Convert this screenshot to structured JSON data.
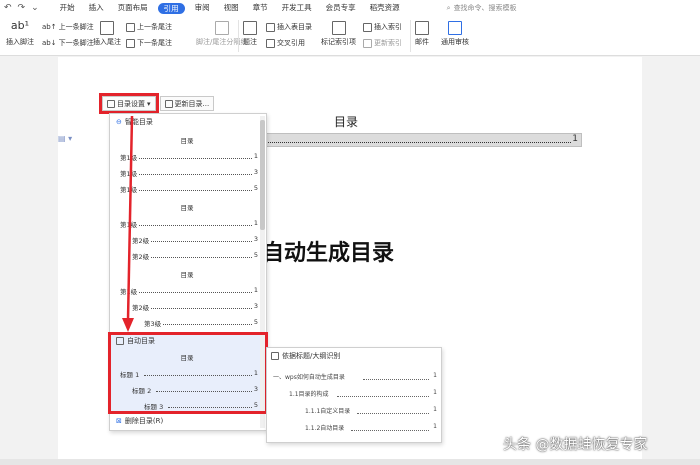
{
  "menubar": {
    "tabs": [
      "开始",
      "插入",
      "页面布局",
      "引用",
      "审阅",
      "视图",
      "章节",
      "开发工具",
      "会员专享",
      "稻壳资源"
    ],
    "search_placeholder": "查找命令、搜索模板"
  },
  "ribbon": {
    "insert_footnote": "插入脚注",
    "prev_footnote": "上一条脚注",
    "next_footnote": "下一条脚注",
    "insert_endnote": "插入尾注",
    "prev_endnote": "上一条尾注",
    "next_endnote": "下一条尾注",
    "footnote_separator": "脚注/尾注分隔线",
    "caption": "题注",
    "insert_table_of_figures": "插入表目录",
    "cross_reference": "交叉引用",
    "mark_index_entry": "标记索引项",
    "insert_index": "插入索引",
    "update_index": "更新索引",
    "mail": "邮件",
    "general_review": "通用审核"
  },
  "toolbar": {
    "toc_settings": "目录设置",
    "update_toc": "更新目录..."
  },
  "document": {
    "toc_title": "目录",
    "toc_page": "1",
    "heading": "自动生成目录"
  },
  "dropdown": {
    "smart_toc": "智能目录",
    "previews": [
      {
        "title": "目录",
        "rows": [
          {
            "label": "第1级",
            "page": "1",
            "indent": 0
          },
          {
            "label": "第1级",
            "page": "3",
            "indent": 0
          },
          {
            "label": "第1级",
            "page": "5",
            "indent": 0
          }
        ]
      },
      {
        "title": "目录",
        "rows": [
          {
            "label": "第1级",
            "page": "1",
            "indent": 0
          },
          {
            "label": "第2级",
            "page": "3",
            "indent": 1
          },
          {
            "label": "第2级",
            "page": "5",
            "indent": 1
          }
        ]
      },
      {
        "title": "目录",
        "rows": [
          {
            "label": "第1级",
            "page": "1",
            "indent": 0
          },
          {
            "label": "第2级",
            "page": "3",
            "indent": 1
          },
          {
            "label": "第3级",
            "page": "5",
            "indent": 2
          }
        ]
      }
    ],
    "auto_toc": "自动目录",
    "auto_preview": {
      "title": "目录",
      "rows": [
        {
          "label": "标题 1",
          "page": "1",
          "indent": 0
        },
        {
          "label": "标题 2",
          "page": "3",
          "indent": 1
        },
        {
          "label": "标题 3",
          "page": "5",
          "indent": 2
        }
      ]
    },
    "delete_toc": "删除目录(R)"
  },
  "flyout": {
    "title": "依据标题/大纲识别",
    "rows": [
      {
        "label": "一、wps如何自动生成目录",
        "page": "1",
        "indent": 0
      },
      {
        "label": "1.1目录的构成",
        "page": "1",
        "indent": 1
      },
      {
        "label": "1.1.1自定义目录",
        "page": "1",
        "indent": 2
      },
      {
        "label": "1.1.2自动目录",
        "page": "1",
        "indent": 2
      }
    ]
  },
  "watermark": "头条 @数据蛙恢复专家",
  "colors": {
    "accent": "#2f6fe4",
    "highlight": "#e3232b",
    "auto_bg": "#e8eefb"
  }
}
